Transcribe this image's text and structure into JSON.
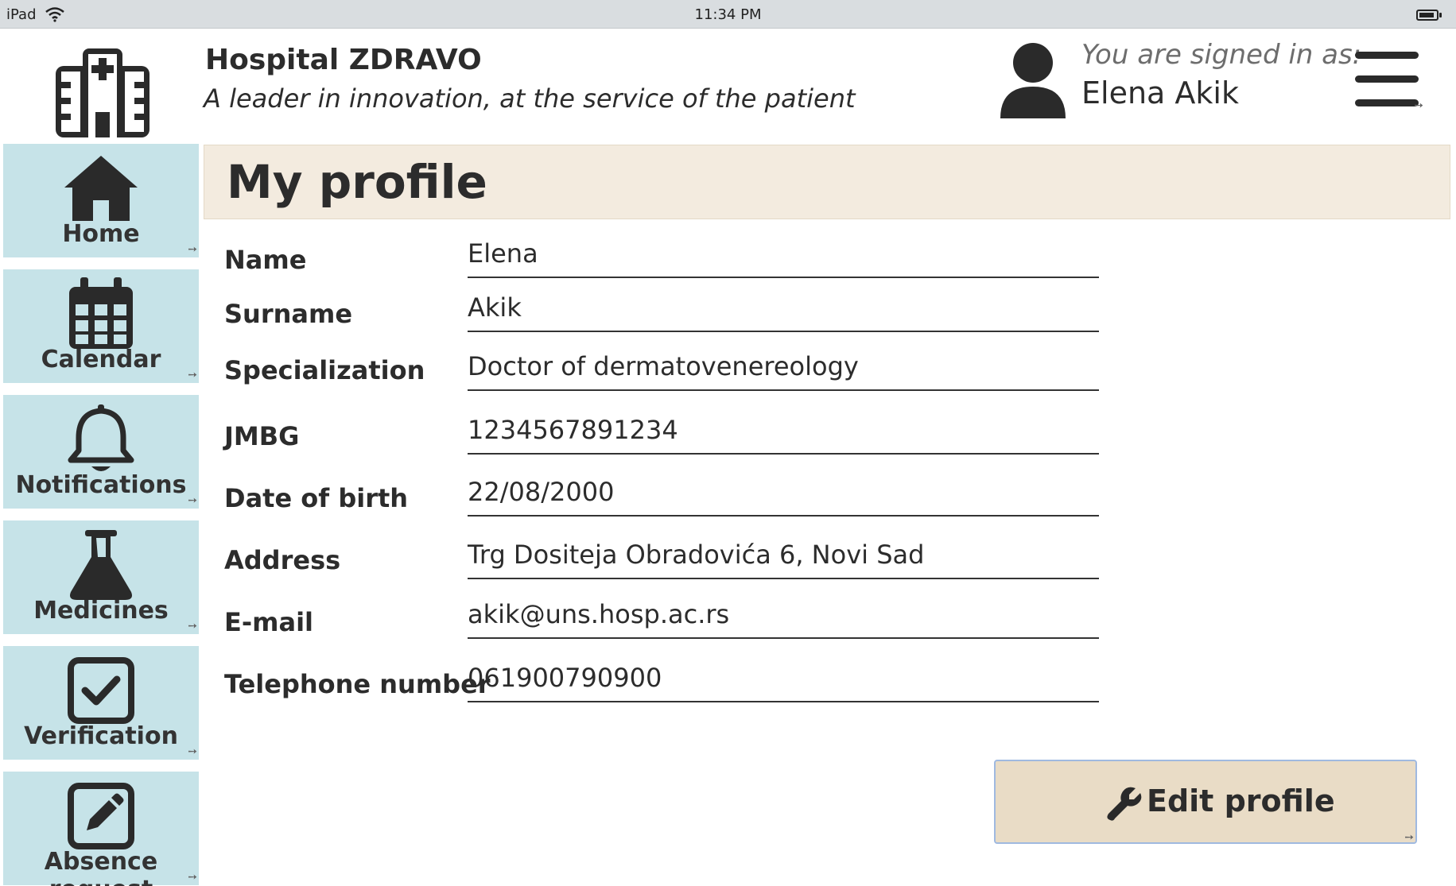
{
  "status_bar": {
    "device": "iPad",
    "time": "11:34 PM"
  },
  "header": {
    "hospital_name": "Hospital ZDRAVO",
    "tagline": "A leader in innovation, at the service of the patient",
    "signed_in_label": "You are signed in as:",
    "user_name": "Elena Akik",
    "logo_icon": "hospital-icon",
    "menu_icon": "hamburger-menu-icon"
  },
  "sidebar": {
    "items": [
      {
        "label": "Home",
        "icon": "home-icon"
      },
      {
        "label": "Calendar",
        "icon": "calendar-icon"
      },
      {
        "label": "Notifications",
        "icon": "bell-icon"
      },
      {
        "label": "Medicines",
        "icon": "flask-icon"
      },
      {
        "label": "Verification",
        "icon": "checkbox-icon"
      },
      {
        "label": "Absence request",
        "icon": "edit-icon"
      }
    ]
  },
  "main": {
    "title": "My profile",
    "fields": [
      {
        "label": "Name",
        "value": "Elena"
      },
      {
        "label": "Surname",
        "value": "Akik"
      },
      {
        "label": "Specialization",
        "value": "Doctor of dermatovenereology"
      },
      {
        "label": "JMBG",
        "value": "1234567891234"
      },
      {
        "label": "Date of birth",
        "value": "22/08/2000"
      },
      {
        "label": "Address",
        "value": "Trg Dositeja Obradovića 6, Novi Sad"
      },
      {
        "label": "E-mail",
        "value": "akik@uns.hosp.ac.rs"
      },
      {
        "label": "Telephone number",
        "value": "061900790900"
      }
    ],
    "edit_button": {
      "label": "Edit profile",
      "icon": "wrench-icon"
    }
  },
  "colors": {
    "sidebar_bg": "#c6e3e8",
    "title_bar_bg": "#f3ebdf",
    "button_bg": "#e9dcc6",
    "text": "#2c2c2c"
  }
}
